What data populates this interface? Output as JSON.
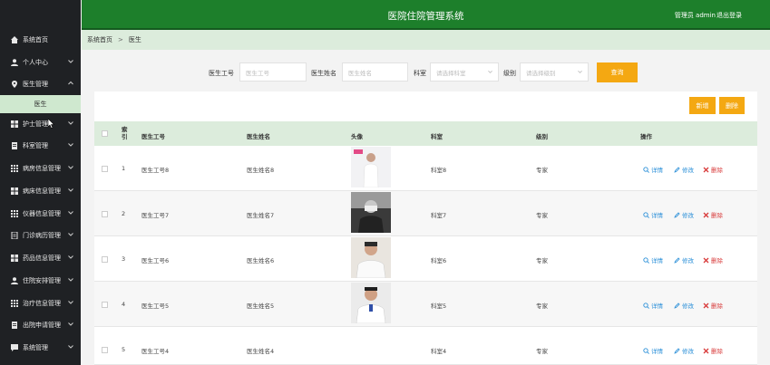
{
  "sidebar": {
    "items": [
      {
        "label": "系统首页",
        "icon": "home-icon"
      },
      {
        "label": "个人中心",
        "icon": "user-icon"
      },
      {
        "label": "医生管理",
        "icon": "pin-icon"
      },
      {
        "label": "护士管理",
        "icon": "grid-icon"
      },
      {
        "label": "科室管理",
        "icon": "doc-icon"
      },
      {
        "label": "病房信息管理",
        "icon": "grid-icon"
      },
      {
        "label": "病床信息管理",
        "icon": "grid-icon"
      },
      {
        "label": "仪器信息管理",
        "icon": "grid-icon"
      },
      {
        "label": "门诊病历管理",
        "icon": "doc-icon"
      },
      {
        "label": "药品信息管理",
        "icon": "grid-icon"
      },
      {
        "label": "住院安排管理",
        "icon": "user-icon"
      },
      {
        "label": "治疗信息管理",
        "icon": "grid-icon"
      },
      {
        "label": "出院申请管理",
        "icon": "doc-icon"
      },
      {
        "label": "系统管理",
        "icon": "chat-icon"
      }
    ],
    "sub_item": "医生"
  },
  "header": {
    "title": "医院住院管理系统",
    "admin": "管理员 admin",
    "logout": "退出登录"
  },
  "breadcrumb": {
    "home": "系统首页",
    "sep": ">",
    "current": "医生"
  },
  "search": {
    "label_id": "医生工号",
    "placeholder_id": "医生工号",
    "label_name": "医生姓名",
    "placeholder_name": "医生姓名",
    "label_dept": "科室",
    "placeholder_dept": "请选择科室",
    "label_level": "级别",
    "placeholder_level": "请选择级别",
    "query_button": "查询"
  },
  "toolbar": {
    "add": "新增",
    "delete": "删除"
  },
  "table": {
    "headers": {
      "index": "索引",
      "id": "医生工号",
      "name": "医生姓名",
      "avatar": "头像",
      "dept": "科室",
      "level": "级别",
      "ops": "操作"
    },
    "rows": [
      {
        "index": "1",
        "id": "医生工号8",
        "name": "医生姓名8",
        "dept": "科室8",
        "level": "专家",
        "avatar": true
      },
      {
        "index": "2",
        "id": "医生工号7",
        "name": "医生姓名7",
        "dept": "科室7",
        "level": "专家",
        "avatar": true
      },
      {
        "index": "3",
        "id": "医生工号6",
        "name": "医生姓名6",
        "dept": "科室6",
        "level": "专家",
        "avatar": true
      },
      {
        "index": "4",
        "id": "医生工号5",
        "name": "医生姓名5",
        "dept": "科室5",
        "level": "专家",
        "avatar": true
      },
      {
        "index": "5",
        "id": "医生工号4",
        "name": "医生姓名4",
        "dept": "科室4",
        "level": "专家",
        "avatar": false
      }
    ],
    "actions": {
      "detail": "详情",
      "edit": "修改",
      "delete": "删除"
    }
  },
  "colors": {
    "header_green": "#1d7f2b",
    "sidebar_bg": "#1f2124",
    "light_green": "#dcecdc",
    "orange": "#f4a812"
  }
}
